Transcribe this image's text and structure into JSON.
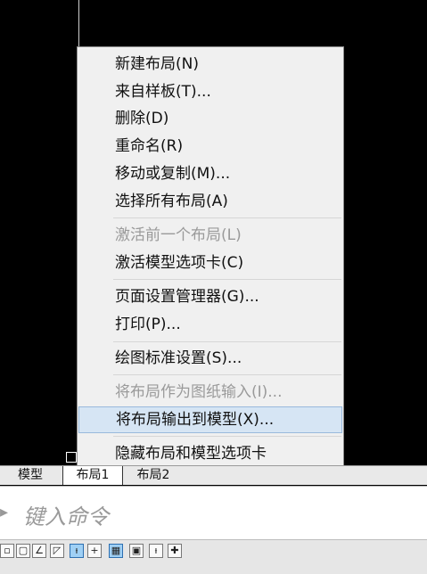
{
  "context_menu": {
    "items": [
      {
        "label": "新建布局(N)",
        "disabled": false
      },
      {
        "label": "来自样板(T)...",
        "disabled": false
      },
      {
        "label": "删除(D)",
        "disabled": false
      },
      {
        "label": "重命名(R)",
        "disabled": false
      },
      {
        "label": "移动或复制(M)...",
        "disabled": false
      },
      {
        "label": "选择所有布局(A)",
        "disabled": false
      },
      {
        "label": "激活前一个布局(L)",
        "disabled": true
      },
      {
        "label": "激活模型选项卡(C)",
        "disabled": false
      },
      {
        "label": "页面设置管理器(G)...",
        "disabled": false
      },
      {
        "label": "打印(P)...",
        "disabled": false
      },
      {
        "label": "绘图标准设置(S)...",
        "disabled": false
      },
      {
        "label": "将布局作为图纸输入(I)...",
        "disabled": true
      },
      {
        "label": "将布局输出到模型(X)...",
        "disabled": false,
        "highlighted": true
      },
      {
        "label": "隐藏布局和模型选项卡",
        "disabled": false
      }
    ]
  },
  "tabs": {
    "model": "模型",
    "layout1": "布局1",
    "layout2": "布局2",
    "active": "layout1"
  },
  "command_line": {
    "caret": "▸",
    "placeholder": "键入命令"
  },
  "status_bar": {
    "icons": [
      "snap-icon",
      "grid-icon",
      "polar-icon",
      "osnap-icon",
      "otrack-icon",
      "ortho-icon",
      "dyn-input-icon",
      "lineweight-icon",
      "transparency-icon",
      "selection-cycle-icon"
    ]
  },
  "colors": {
    "canvas": "#000000",
    "menu_bg": "#f0f0f0",
    "highlight": "#d6e5f4",
    "disabled_text": "#9a9a9a"
  }
}
